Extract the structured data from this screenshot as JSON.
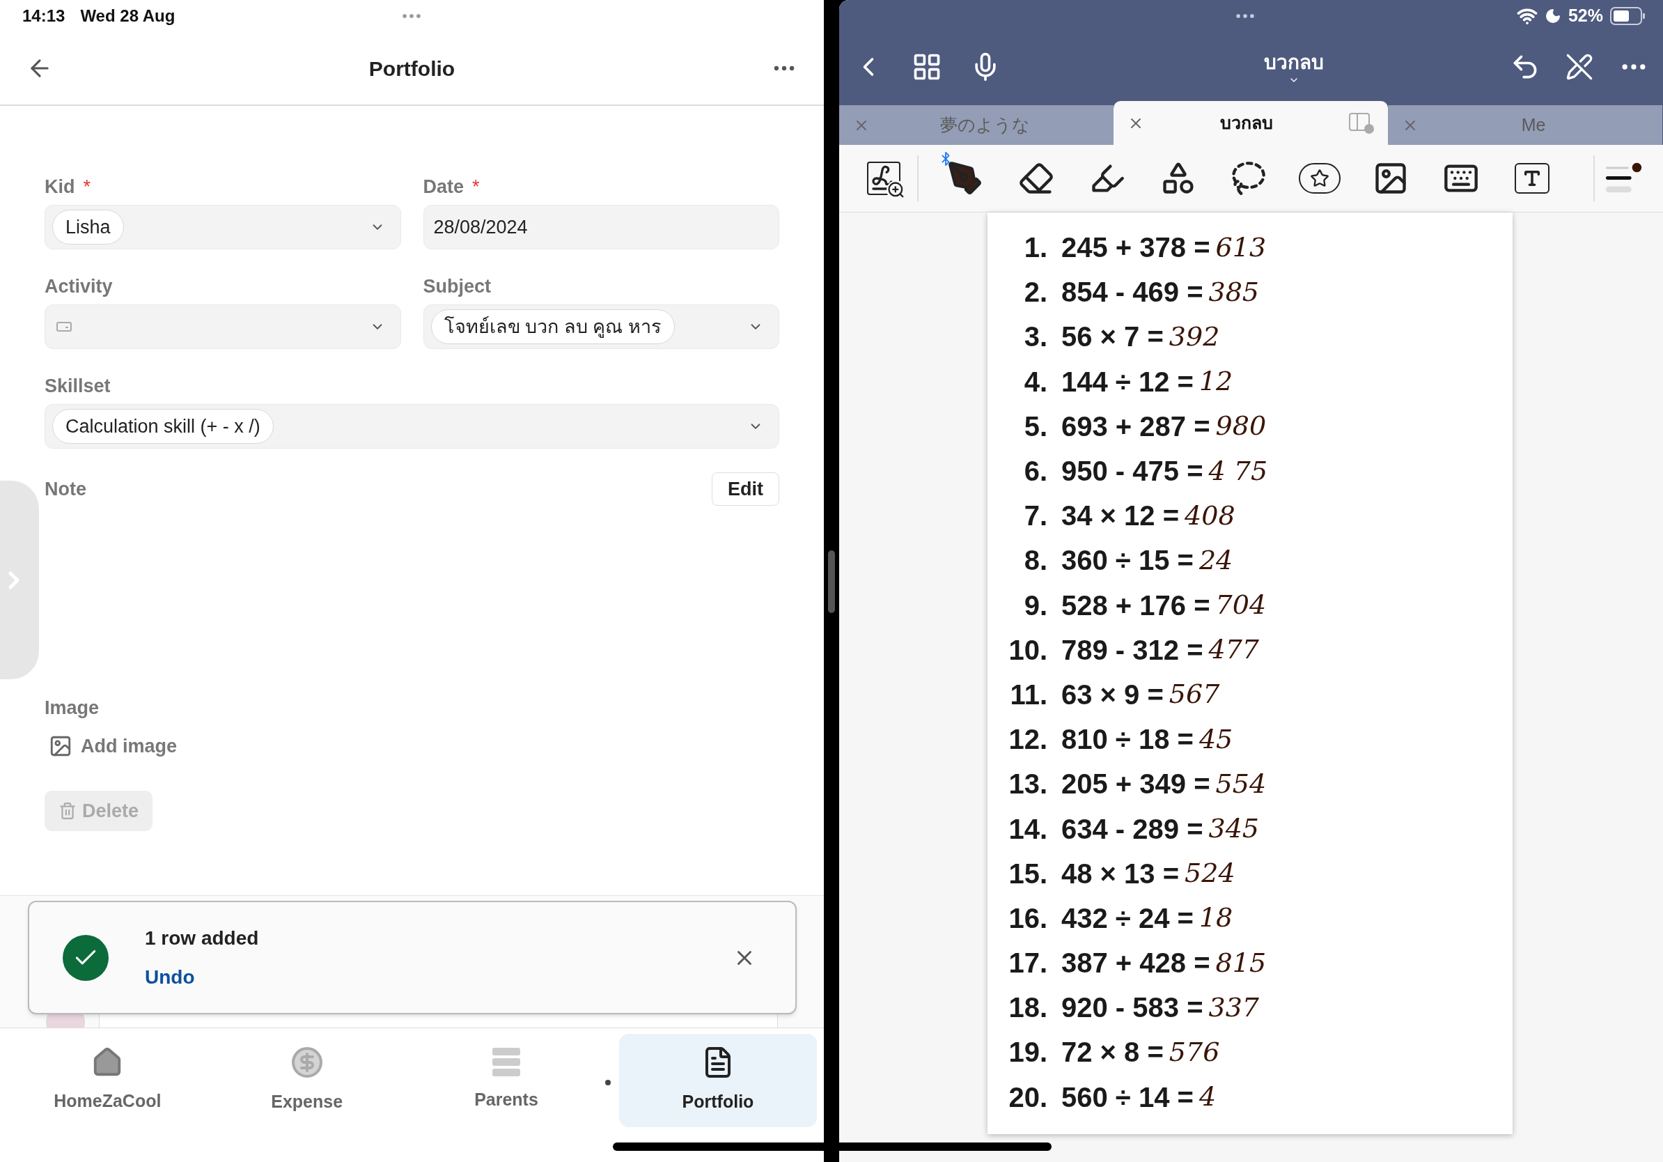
{
  "status_bar": {
    "time": "14:13",
    "date": "Wed 28 Aug",
    "battery": "52%"
  },
  "left_pane": {
    "header": {
      "title": "Portfolio"
    },
    "form_rows": [
      [
        {
          "label": "Kid",
          "required_mark": "*",
          "kind": "chip-select",
          "value": "Lisha"
        },
        {
          "label": "Date",
          "required_mark": "*",
          "kind": "text",
          "value": "28/08/2024"
        }
      ],
      [
        {
          "label": "Activity",
          "kind": "empty-select"
        },
        {
          "label": "Subject",
          "kind": "chip-select",
          "value": "โจทย์เลข บวก ลบ คูณ หาร"
        }
      ],
      [
        {
          "label": "Skillset",
          "kind": "chip-select",
          "value": "Calculation skill (+ - x /)"
        }
      ]
    ],
    "note": {
      "label": "Note",
      "edit_button": "Edit"
    },
    "image": {
      "label": "Image",
      "add_button": "Add image"
    },
    "delete_button": "Delete",
    "toast": {
      "message": "1 row added",
      "action": "Undo"
    },
    "nav": [
      {
        "label": "HomeZaCool",
        "kind": "home",
        "selected": false
      },
      {
        "label": "Expense",
        "kind": "coin",
        "selected": false
      },
      {
        "label": "Parents",
        "kind": "stack",
        "selected": false
      },
      {
        "label": "Portfolio",
        "kind": "document",
        "selected": true
      }
    ]
  },
  "right_pane": {
    "title": "บวกลบ",
    "tabs": [
      {
        "label": "夢のような",
        "selected": false
      },
      {
        "label": "บวกลบ",
        "selected": true
      },
      {
        "label": "Me",
        "selected": false
      }
    ],
    "worksheet": [
      {
        "number": "1.",
        "equation": "245 + 378 =",
        "answer": "613"
      },
      {
        "number": "2.",
        "equation": "854 - 469 =",
        "answer": "385"
      },
      {
        "number": "3.",
        "equation": "56 × 7 =",
        "answer": "392"
      },
      {
        "number": "4.",
        "equation": "144 ÷ 12 =",
        "answer": "12"
      },
      {
        "number": "5.",
        "equation": "693 + 287 =",
        "answer": "980"
      },
      {
        "number": "6.",
        "equation": "950 - 475 =",
        "answer": "4 75"
      },
      {
        "number": "7.",
        "equation": "34 × 12 =",
        "answer": "408"
      },
      {
        "number": "8.",
        "equation": "360 ÷ 15 =",
        "answer": "24"
      },
      {
        "number": "9.",
        "equation": "528 + 176 =",
        "answer": "704"
      },
      {
        "number": "10.",
        "equation": "789 - 312 =",
        "answer": "477"
      },
      {
        "number": "11.",
        "equation": "63 × 9 =",
        "answer": "567"
      },
      {
        "number": "12.",
        "equation": "810 ÷ 18 =",
        "answer": "45"
      },
      {
        "number": "13.",
        "equation": "205 + 349 =",
        "answer": "554"
      },
      {
        "number": "14.",
        "equation": "634 - 289 =",
        "answer": "345"
      },
      {
        "number": "15.",
        "equation": "48 × 13 =",
        "answer": "524"
      },
      {
        "number": "16.",
        "equation": "432 ÷ 24 =",
        "answer": "18"
      },
      {
        "number": "17.",
        "equation": "387 + 428 =",
        "answer": "815"
      },
      {
        "number": "18.",
        "equation": "920 - 583 =",
        "answer": "337"
      },
      {
        "number": "19.",
        "equation": "72 × 8 =",
        "answer": "576"
      },
      {
        "number": "20.",
        "equation": "560 ÷ 14 =",
        "answer": "4"
      }
    ]
  }
}
